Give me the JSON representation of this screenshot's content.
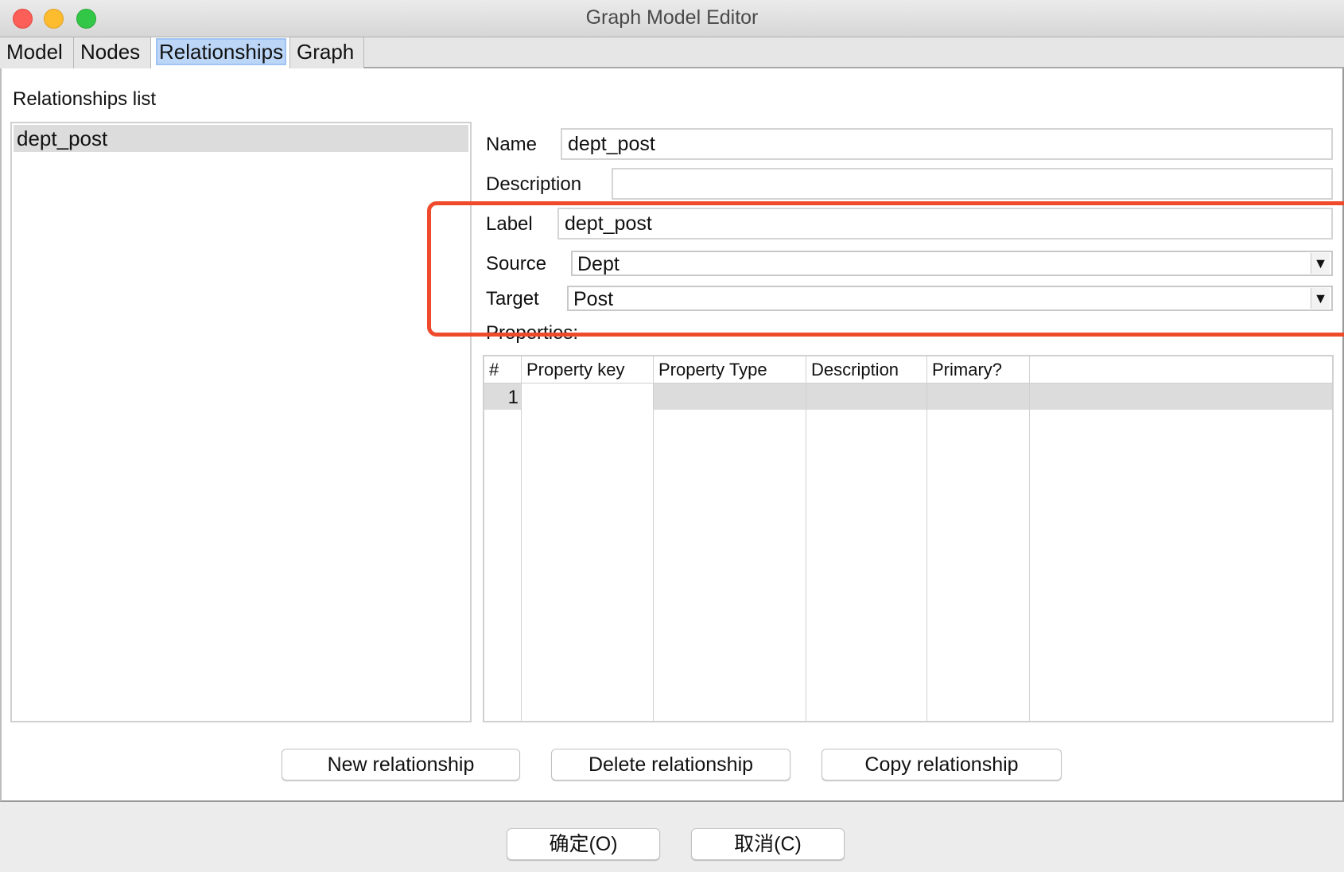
{
  "window": {
    "title": "Graph Model Editor",
    "controls": [
      "close",
      "minimize",
      "maximize"
    ]
  },
  "tabs": [
    {
      "label": "Model",
      "active": false
    },
    {
      "label": "Nodes",
      "active": false
    },
    {
      "label": "Relationships",
      "active": true
    },
    {
      "label": "Graph",
      "active": false
    }
  ],
  "list": {
    "title": "Relationships list",
    "items": [
      {
        "label": "dept_post",
        "selected": true
      }
    ]
  },
  "form": {
    "name_label": "Name",
    "name_value": "dept_post",
    "description_label": "Description",
    "description_value": "",
    "label_label": "Label",
    "label_value": "dept_post",
    "source_label": "Source",
    "source_value": "Dept",
    "target_label": "Target",
    "target_value": "Post",
    "dropdown_glyph": "▼"
  },
  "properties": {
    "title": "Properties:",
    "columns": [
      "#",
      "Property key",
      "Property Type",
      "Description",
      "Primary?"
    ],
    "rows": [
      {
        "index": "1",
        "key": "",
        "type": "",
        "description": "",
        "primary": ""
      }
    ]
  },
  "actions": {
    "new": "New relationship",
    "delete": "Delete relationship",
    "copy": "Copy relationship"
  },
  "dialog": {
    "ok": "确定(O)",
    "cancel": "取消(C)"
  },
  "highlight": {
    "color": "#f04a2c"
  }
}
